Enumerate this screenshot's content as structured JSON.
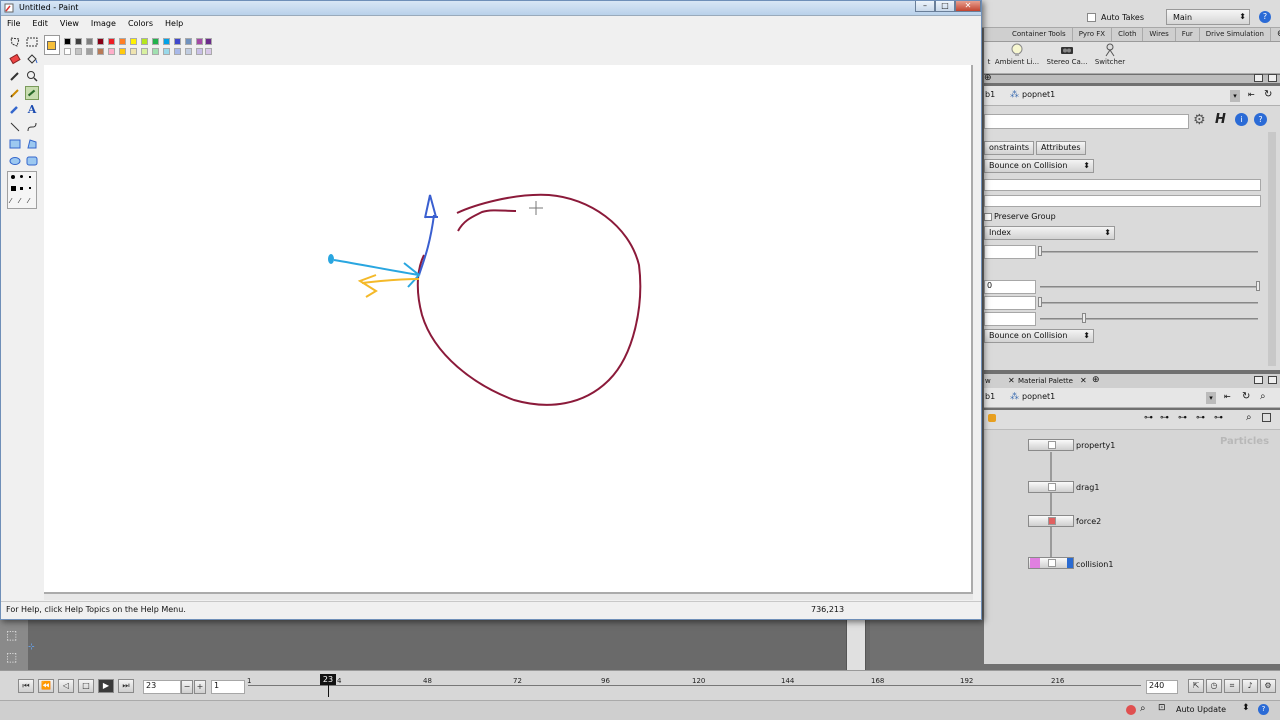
{
  "paint": {
    "title": "Untitled - Paint",
    "menu": [
      "File",
      "Edit",
      "View",
      "Image",
      "Colors",
      "Help"
    ],
    "status_help": "For Help, click Help Topics on the Help Menu.",
    "status_coords": "736,213",
    "foreground_color": "#f6bf3a",
    "palette_colors": [
      "#000000",
      "#7f7f7f",
      "#880015",
      "#ed1c24",
      "#ff7f27",
      "#fff200",
      "#22b14c",
      "#00a2e8",
      "#3f48cc",
      "#a349a4",
      "#ffffff",
      "#c3c3c3",
      "#b97a57",
      "#ffaec9",
      "#ffc90e",
      "#efe4b0",
      "#b5e61d",
      "#99d9ea",
      "#7092be",
      "#c8bfe7"
    ],
    "drawing_colors": {
      "circle": "#8b1a3a",
      "arrow_blue": "#29a6e0",
      "arrow_yellow": "#f4b929",
      "line_blue": "#3a5fd0"
    }
  },
  "houdini": {
    "take_checkbox": "Auto Takes",
    "desktop": "Main",
    "shelf_tabs": [
      "Container Tools",
      "Pyro FX",
      "Cloth",
      "Wires",
      "Fur",
      "Drive Simulation"
    ],
    "shelf_tools": [
      "t",
      "Ambient Li...",
      "Stereo Ca...",
      "Switcher"
    ],
    "param_path": "popnet1",
    "param_path_prefix": "b1",
    "param_tabs": [
      "onstraints",
      "Attributes"
    ],
    "behavior": "Bounce on Collision",
    "preserve_group": "Preserve Group",
    "index_menu": "Index",
    "field_value": "0",
    "behavior2": "Bounce on Collision",
    "network_tabs": [
      "w",
      "Material Palette"
    ],
    "network_path": "popnet1",
    "network_path_prefix": "b1",
    "network_label": "Particles",
    "nodes": [
      "property1",
      "drag1",
      "force2",
      "collision1"
    ],
    "frame": "23",
    "step": "1",
    "current_frame_marker": "23",
    "ticks": [
      "1",
      "4",
      "48",
      "72",
      "96",
      "120",
      "144",
      "168",
      "192",
      "216"
    ],
    "end_frame": "240",
    "auto_update": "Auto Update"
  }
}
